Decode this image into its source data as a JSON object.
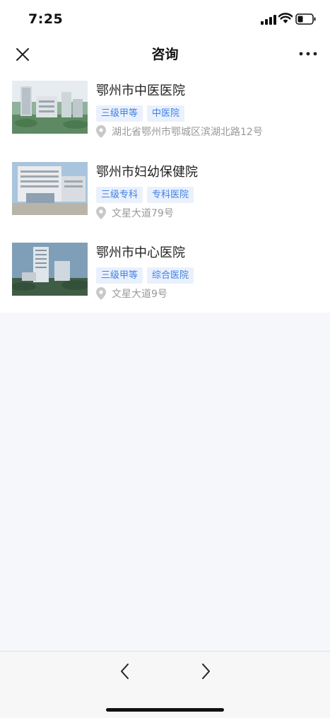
{
  "status_bar": {
    "time": "7:25"
  },
  "header": {
    "title": "咨询",
    "close_icon": "close-icon",
    "more_icon": "more-icon"
  },
  "hospitals": [
    {
      "name": "鄂州市中医医院",
      "tags": [
        "三级甲等",
        "中医院"
      ],
      "address": "湖北省鄂州市鄂城区滨湖北路12号"
    },
    {
      "name": "鄂州市妇幼保健院",
      "tags": [
        "三级专科",
        "专科医院"
      ],
      "address": "文星大道79号"
    },
    {
      "name": "鄂州市中心医院",
      "tags": [
        "三级甲等",
        "综合医院"
      ],
      "address": "文星大道9号"
    }
  ],
  "toolbar": {
    "back_icon": "chevron-left-icon",
    "forward_icon": "chevron-right-icon"
  },
  "colors": {
    "tag_text": "#3f7fe6",
    "tag_bg": "#eaf1fd",
    "page_bg": "#f6f7fa"
  }
}
